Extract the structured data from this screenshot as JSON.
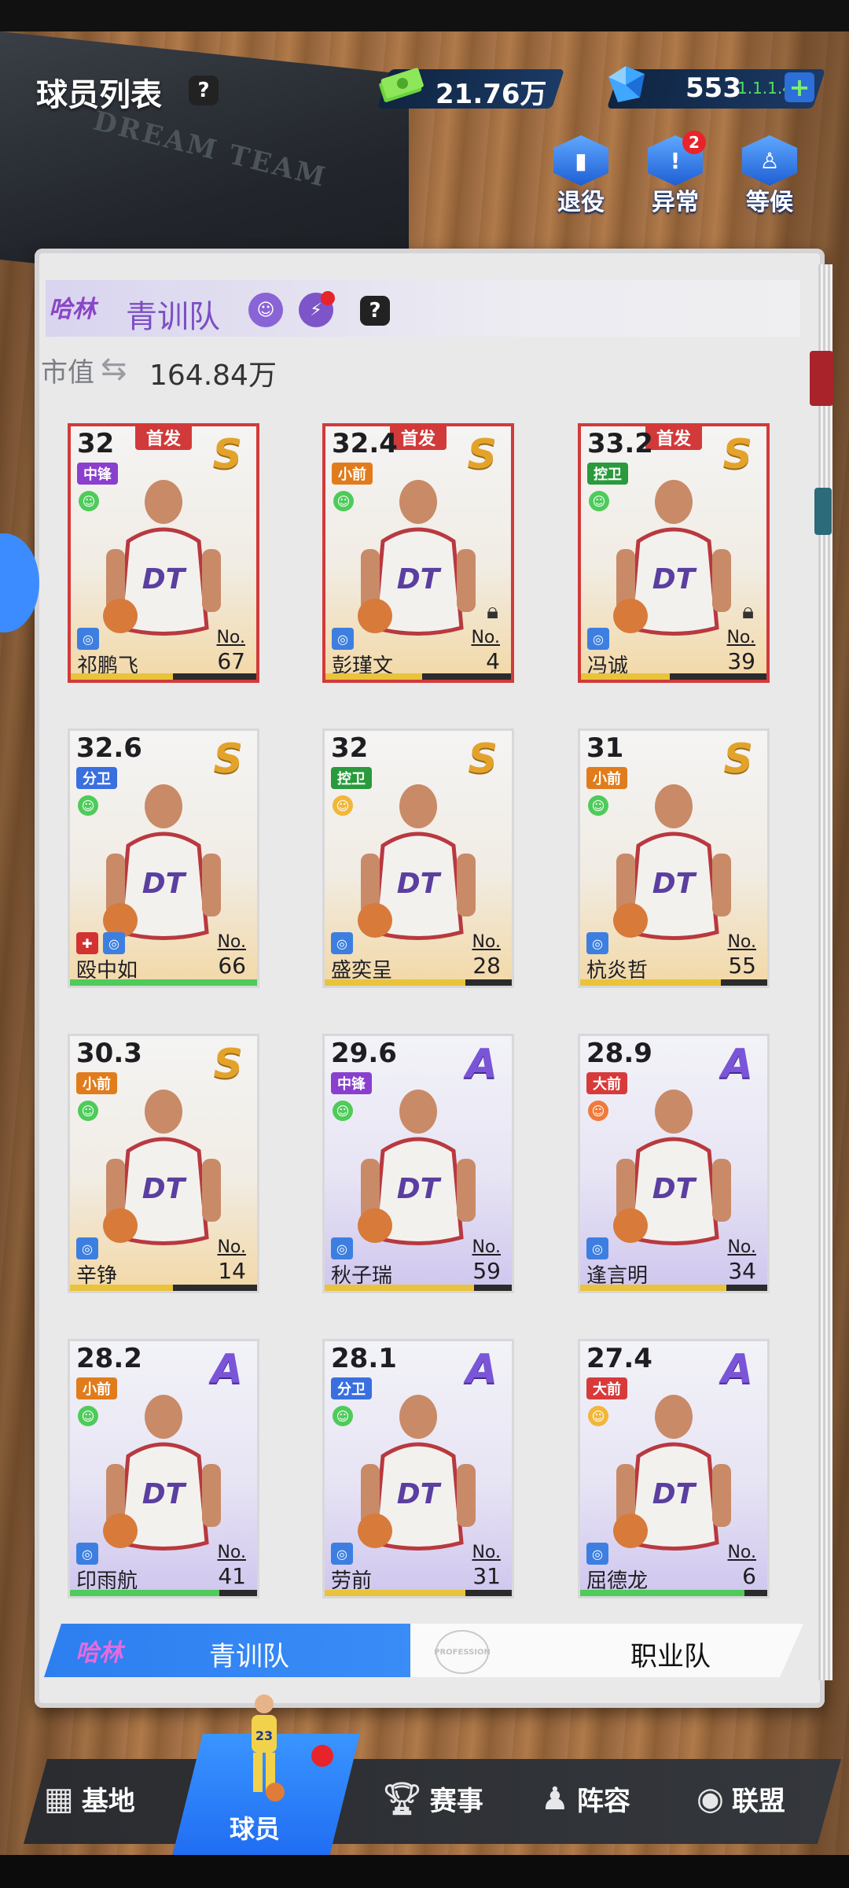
{
  "header": {
    "title": "球员列表",
    "help": "?",
    "cash": "21.76万",
    "gems": "553",
    "version": "1.1.1.421",
    "buttons": [
      {
        "label": "退役",
        "icon": "retire-icon",
        "badge": ""
      },
      {
        "label": "异常",
        "icon": "warning-icon",
        "badge": "2"
      },
      {
        "label": "等候",
        "icon": "waiting-icon",
        "badge": ""
      }
    ]
  },
  "book_text": "DREAM TEAM",
  "team": {
    "logo": "哈林",
    "name": "青训队",
    "help": "?",
    "market_label": "市值",
    "market_value": "164.84万"
  },
  "colors": {
    "accent": "#2d7ff0",
    "starter": "#d23a3a",
    "rank_s": "#e3a32b",
    "rank_a": "#7a55d8"
  },
  "players": [
    {
      "rating": "32",
      "pos": "中锋",
      "pos_color": "#8a3fcf",
      "rank": "S",
      "mood": "happy",
      "mood_color": "#4ecb5a",
      "name": "祁鹏飞",
      "no": "67",
      "starter": true,
      "tag": "首发",
      "lock": false,
      "med": false,
      "bar_color": "#e9c33b",
      "bar_fill": 0.55
    },
    {
      "rating": "32.4",
      "pos": "小前",
      "pos_color": "#e07c1c",
      "rank": "S",
      "mood": "happy",
      "mood_color": "#4ecb5a",
      "name": "彭瑾文",
      "no": "4",
      "starter": true,
      "tag": "首发",
      "lock": true,
      "med": false,
      "bar_color": "#e9c33b",
      "bar_fill": 0.52
    },
    {
      "rating": "33.2",
      "pos": "控卫",
      "pos_color": "#2a9a3d",
      "rank": "S",
      "mood": "happy",
      "mood_color": "#4ecb5a",
      "name": "冯诚",
      "no": "39",
      "starter": true,
      "tag": "首发",
      "lock": true,
      "med": false,
      "bar_color": "#e9c33b",
      "bar_fill": 0.48
    },
    {
      "rating": "32.6",
      "pos": "分卫",
      "pos_color": "#3a6fe0",
      "rank": "S",
      "mood": "happy",
      "mood_color": "#4ecb5a",
      "name": "殴中如",
      "no": "66",
      "starter": false,
      "tag": "",
      "lock": false,
      "med": true,
      "bar_color": "#4ecb5a",
      "bar_fill": 1.0
    },
    {
      "rating": "32",
      "pos": "控卫",
      "pos_color": "#2a9a3d",
      "rank": "S",
      "mood": "neutral",
      "mood_color": "#f0b73b",
      "name": "盛奕呈",
      "no": "28",
      "starter": false,
      "tag": "",
      "lock": false,
      "med": false,
      "bar_color": "#e9c33b",
      "bar_fill": 0.75
    },
    {
      "rating": "31",
      "pos": "小前",
      "pos_color": "#e07c1c",
      "rank": "S",
      "mood": "happy",
      "mood_color": "#4ecb5a",
      "name": "杭炎哲",
      "no": "55",
      "starter": false,
      "tag": "",
      "lock": false,
      "med": false,
      "bar_color": "#e9c33b",
      "bar_fill": 0.75
    },
    {
      "rating": "30.3",
      "pos": "小前",
      "pos_color": "#e07c1c",
      "rank": "S",
      "mood": "happy",
      "mood_color": "#4ecb5a",
      "name": "辛铮",
      "no": "14",
      "starter": false,
      "tag": "",
      "lock": false,
      "med": false,
      "bar_color": "#e9c33b",
      "bar_fill": 0.55
    },
    {
      "rating": "29.6",
      "pos": "中锋",
      "pos_color": "#8a3fcf",
      "rank": "A",
      "mood": "happy",
      "mood_color": "#4ecb5a",
      "name": "秋子瑞",
      "no": "59",
      "starter": false,
      "tag": "",
      "lock": false,
      "med": false,
      "bar_color": "#e9c33b",
      "bar_fill": 0.8
    },
    {
      "rating": "28.9",
      "pos": "大前",
      "pos_color": "#d83a3a",
      "rank": "A",
      "mood": "sad",
      "mood_color": "#f07a3b",
      "name": "逢言明",
      "no": "34",
      "starter": false,
      "tag": "",
      "lock": false,
      "med": false,
      "bar_color": "#e9c33b",
      "bar_fill": 0.78
    },
    {
      "rating": "28.2",
      "pos": "小前",
      "pos_color": "#e07c1c",
      "rank": "A",
      "mood": "happy",
      "mood_color": "#4ecb5a",
      "name": "印雨航",
      "no": "41",
      "starter": false,
      "tag": "",
      "lock": false,
      "med": false,
      "bar_color": "#4ecb5a",
      "bar_fill": 0.8
    },
    {
      "rating": "28.1",
      "pos": "分卫",
      "pos_color": "#3a6fe0",
      "rank": "A",
      "mood": "happy",
      "mood_color": "#4ecb5a",
      "name": "劳前",
      "no": "31",
      "starter": false,
      "tag": "",
      "lock": false,
      "med": false,
      "bar_color": "#e9c33b",
      "bar_fill": 0.75
    },
    {
      "rating": "27.4",
      "pos": "大前",
      "pos_color": "#d83a3a",
      "rank": "A",
      "mood": "neutral",
      "mood_color": "#f0b73b",
      "name": "屈德龙",
      "no": "6",
      "starter": false,
      "tag": "",
      "lock": false,
      "med": false,
      "bar_color": "#4ecb5a",
      "bar_fill": 0.88
    }
  ],
  "segments": {
    "left_logo": "哈林",
    "left_label": "青训队",
    "right_logo": "PROFESSION",
    "right_label": "职业队"
  },
  "nav": {
    "items": [
      {
        "label": "基地",
        "icon": "stadium-icon"
      },
      {
        "label": "球员",
        "icon": "player-icon",
        "active": true
      },
      {
        "label": "赛事",
        "icon": "trophy-icon"
      },
      {
        "label": "阵容",
        "icon": "lineup-icon"
      },
      {
        "label": "联盟",
        "icon": "league-icon"
      }
    ],
    "jersey_number": "23"
  }
}
